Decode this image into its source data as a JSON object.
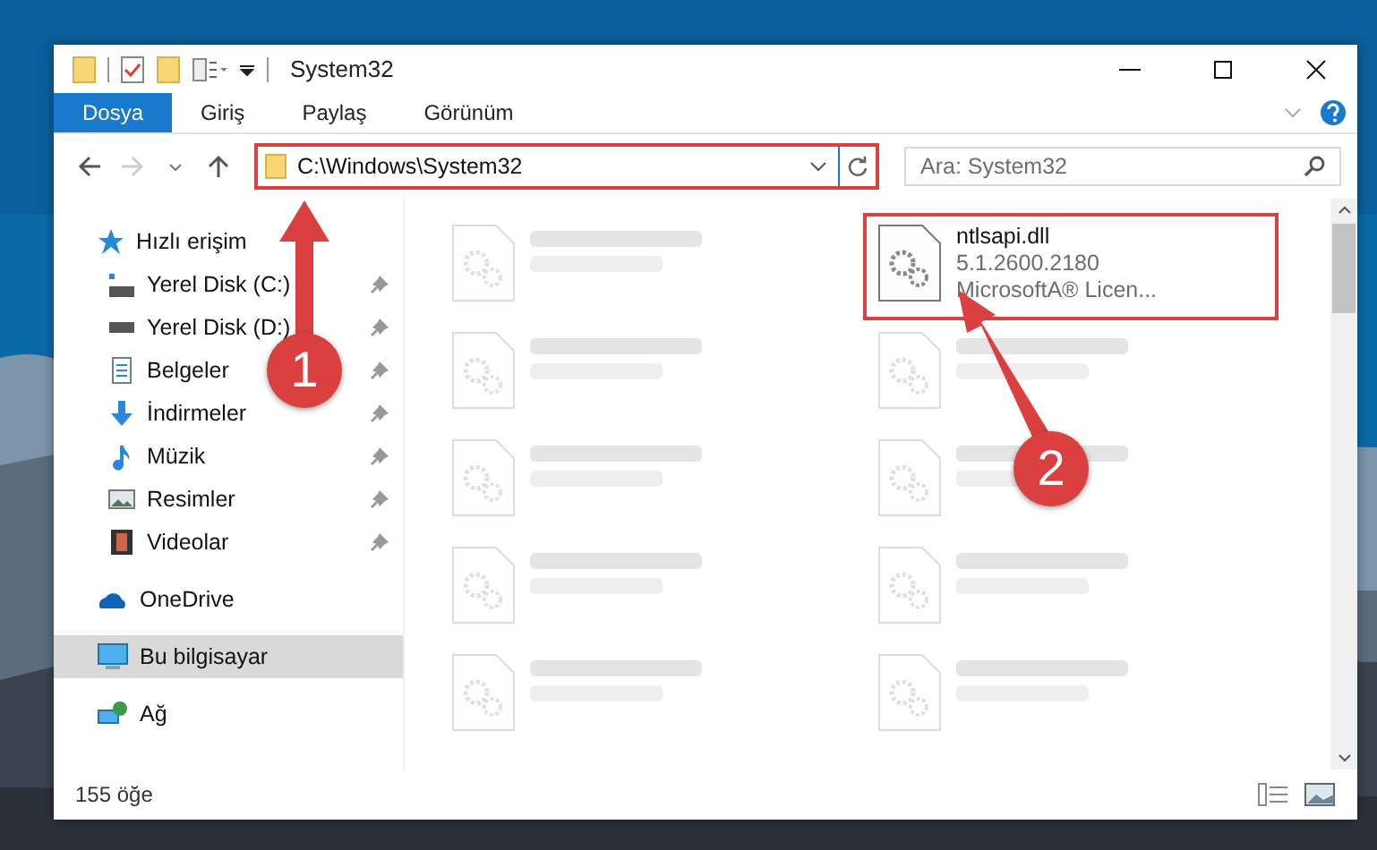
{
  "window": {
    "title": "System32"
  },
  "ribbon_tabs": [
    {
      "label": "Dosya",
      "selected": true
    },
    {
      "label": "Giriş",
      "selected": false
    },
    {
      "label": "Paylaş",
      "selected": false
    },
    {
      "label": "Görünüm",
      "selected": false
    }
  ],
  "address": {
    "value": "C:\\Windows\\System32",
    "highlighted": true
  },
  "search": {
    "placeholder": "Ara: System32"
  },
  "sidebar": {
    "items": [
      {
        "label": "Hızlı erişim",
        "kind": "star",
        "selected": false,
        "children": [
          {
            "label": "Yerel Disk (C:)",
            "kind": "drive-c",
            "pinned": true
          },
          {
            "label": "Yerel Disk (D:)",
            "kind": "drive",
            "pinned": true
          },
          {
            "label": "Belgeler",
            "kind": "document",
            "pinned": true
          },
          {
            "label": "İndirmeler",
            "kind": "download",
            "pinned": true
          },
          {
            "label": "Müzik",
            "kind": "music",
            "pinned": true
          },
          {
            "label": "Resimler",
            "pinned": true
          },
          {
            "label": "Videolar",
            "kind": "video",
            "pinned": true
          }
        ]
      },
      {
        "label": "OneDrive",
        "kind": "cloud",
        "selected": false
      },
      {
        "label": "Bu bilgisayar",
        "kind": "computer",
        "selected": true
      },
      {
        "label": "Ağ",
        "kind": "network",
        "selected": false
      }
    ]
  },
  "files": [
    {
      "kind": "blurred"
    },
    {
      "kind": "file",
      "name": "ntlsapi.dll",
      "lines": [
        "5.1.2600.2180",
        "MicrosoftA® Licen..."
      ],
      "highlighted": true
    },
    {
      "kind": "blurred"
    },
    {
      "kind": "blurred"
    },
    {
      "kind": "blurred"
    },
    {
      "kind": "blurred"
    },
    {
      "kind": "blurred"
    },
    {
      "kind": "blurred"
    },
    {
      "kind": "blurred"
    },
    {
      "kind": "blurred"
    }
  ],
  "status_bar": {
    "count": "155 öğe"
  },
  "annotations": [
    {
      "label": "1"
    },
    {
      "label": "2"
    }
  ]
}
